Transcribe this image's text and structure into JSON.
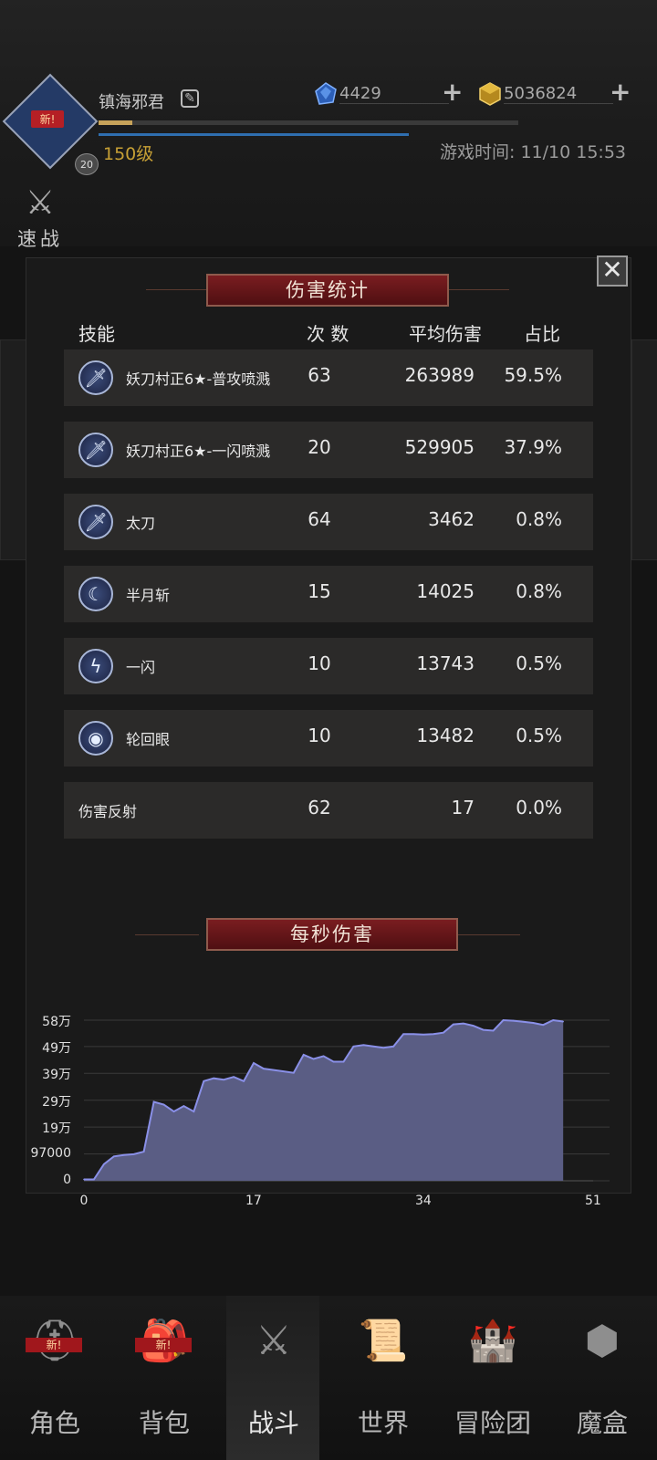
{
  "player": {
    "name": "镇海邪君",
    "level_text": "150级",
    "avatar_badge": "新!",
    "rank_badge": "20",
    "xp_progress": 0.08
  },
  "resources": [
    {
      "icon": "blue-gem-icon",
      "value": "4429"
    },
    {
      "icon": "gold-cube-icon",
      "value": "5036824"
    }
  ],
  "game_time": "游戏时间: 11/10 15:53",
  "quick_battle": {
    "label": "速战"
  },
  "panel": {
    "damage_title": "伤害统计",
    "headers": {
      "skill": "技能",
      "count": "次 数",
      "avg": "平均伤害",
      "share": "占比"
    },
    "rows": [
      {
        "icon": "sword-icon",
        "name": "妖刀村正6★-普攻喷溅",
        "count": "63",
        "avg": "263989",
        "share": "59.5%"
      },
      {
        "icon": "sword-icon",
        "name": "妖刀村正6★-一闪喷溅",
        "count": "20",
        "avg": "529905",
        "share": "37.9%"
      },
      {
        "icon": "sword-icon",
        "name": "太刀",
        "count": "64",
        "avg": "3462",
        "share": "0.8%"
      },
      {
        "icon": "crescent-moon-icon",
        "name": "半月斩",
        "count": "15",
        "avg": "14025",
        "share": "0.8%"
      },
      {
        "icon": "lightning-slash-icon",
        "name": "一闪",
        "count": "10",
        "avg": "13743",
        "share": "0.5%"
      },
      {
        "icon": "eye-vortex-icon",
        "name": "轮回眼",
        "count": "10",
        "avg": "13482",
        "share": "0.5%"
      },
      {
        "icon": "",
        "name": "伤害反射",
        "count": "62",
        "avg": "17",
        "share": "0.0%"
      }
    ],
    "dps_title": "每秒伤害",
    "close_icon": "close-icon"
  },
  "chart_data": {
    "type": "area",
    "title": "每秒伤害",
    "xlabel": "",
    "ylabel": "",
    "xlim": [
      0,
      51
    ],
    "ylim": [
      0,
      580000
    ],
    "x_ticks": [
      "0",
      "17",
      "34",
      "51"
    ],
    "y_ticks": [
      "0",
      "97000",
      "19万",
      "29万",
      "39万",
      "49万",
      "58万"
    ],
    "y_tick_values": [
      0,
      97000,
      194000,
      291000,
      388000,
      485000,
      580000
    ],
    "grid": true,
    "fill_color": "#5a5d84",
    "line_color": "#8a90e8",
    "series": [
      {
        "x": [
          0,
          1,
          2,
          3,
          4,
          5,
          6,
          7,
          8,
          9,
          10,
          11,
          12,
          13,
          14,
          15,
          16,
          17,
          18,
          19,
          20,
          21,
          22,
          23,
          24,
          25,
          26,
          27,
          28,
          29,
          30,
          31,
          32,
          33,
          34,
          35,
          36,
          37,
          38,
          39,
          40,
          41,
          42,
          43,
          44,
          45,
          46,
          47,
          48
        ],
        "values": [
          5000,
          5000,
          60000,
          88000,
          93000,
          96000,
          105000,
          285000,
          275000,
          250000,
          270000,
          250000,
          360000,
          370000,
          365000,
          375000,
          360000,
          425000,
          405000,
          400000,
          395000,
          390000,
          455000,
          440000,
          450000,
          430000,
          430000,
          485000,
          490000,
          485000,
          480000,
          485000,
          530000,
          530000,
          528000,
          530000,
          535000,
          565000,
          568000,
          560000,
          545000,
          542000,
          580000,
          578000,
          574000,
          570000,
          563000,
          580000,
          575000
        ]
      }
    ]
  },
  "nav": {
    "items": [
      {
        "label": "角色",
        "icon": "helmet-icon",
        "badge": "新!"
      },
      {
        "label": "背包",
        "icon": "backpack-icon",
        "badge": "新!"
      },
      {
        "label": "战斗",
        "icon": "sword-shield-icon",
        "badge": ""
      },
      {
        "label": "世界",
        "icon": "map-scroll-icon",
        "badge": ""
      },
      {
        "label": "冒险团",
        "icon": "castle-icon",
        "badge": ""
      },
      {
        "label": "魔盒",
        "icon": "magic-cube-icon",
        "badge": ""
      }
    ],
    "active_index": 2
  }
}
